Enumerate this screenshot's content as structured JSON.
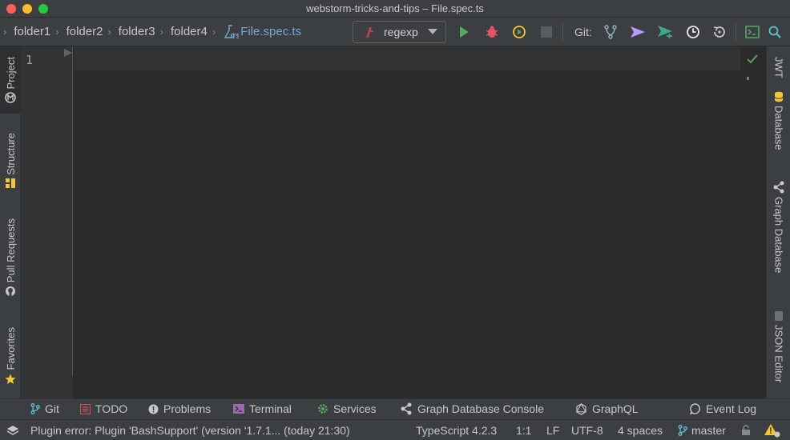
{
  "window": {
    "title": "webstorm-tricks-and-tips – File.spec.ts"
  },
  "breadcrumbs": [
    {
      "label": "folder1"
    },
    {
      "label": "folder2"
    },
    {
      "label": "folder3"
    },
    {
      "label": "folder4"
    },
    {
      "label": "File.spec.ts",
      "icon": "typescript-test-icon"
    }
  ],
  "run_config": {
    "label": "regexp",
    "icon": "bash-config-icon"
  },
  "toolbar": {
    "git_label": "Git:",
    "icons": [
      "run-icon",
      "debug-icon",
      "coverage-icon",
      "stop-icon",
      "git-branch-icon",
      "git-push-icon",
      "git-commit-push-icon",
      "history-icon",
      "rollback-icon",
      "terminal-icon",
      "search-icon"
    ]
  },
  "left_tabs": [
    {
      "label": "Project",
      "icon": "project-icon"
    },
    {
      "label": "Structure",
      "icon": "structure-icon"
    },
    {
      "label": "Pull Requests",
      "icon": "github-icon"
    },
    {
      "label": "Favorites",
      "icon": "star-icon"
    }
  ],
  "right_tabs": [
    {
      "label": "JWT"
    },
    {
      "label": "Database",
      "icon": "database-icon"
    },
    {
      "label": "Graph Database",
      "icon": "graph-icon"
    },
    {
      "label": "JSON Editor",
      "icon": "json-icon"
    }
  ],
  "editor": {
    "line_numbers": [
      "1"
    ]
  },
  "bottom_tools": [
    {
      "label": "Git",
      "icon": "git-branch-icon"
    },
    {
      "label": "TODO",
      "icon": "todo-icon"
    },
    {
      "label": "Problems",
      "icon": "problems-icon"
    },
    {
      "label": "Terminal",
      "icon": "terminal-icon"
    },
    {
      "label": "Services",
      "icon": "services-icon"
    },
    {
      "label": "Graph Database Console",
      "icon": "graph-icon"
    },
    {
      "label": "GraphQL",
      "icon": "graphql-icon"
    },
    {
      "label": "Event Log",
      "icon": "event-log-icon"
    }
  ],
  "status": {
    "message": "Plugin error: Plugin 'BashSupport' (version '1.7.1... (today 21:30)",
    "language": "TypeScript 4.2.3",
    "position": "1:1",
    "line_ending": "LF",
    "encoding": "UTF-8",
    "indent": "4 spaces",
    "branch": "master"
  },
  "colors": {
    "accent_file": "#78a6d8",
    "run_green": "#59a869",
    "debug_red": "#e05561",
    "push_purple": "#b99bf8",
    "warning_yellow": "#f4c534"
  }
}
